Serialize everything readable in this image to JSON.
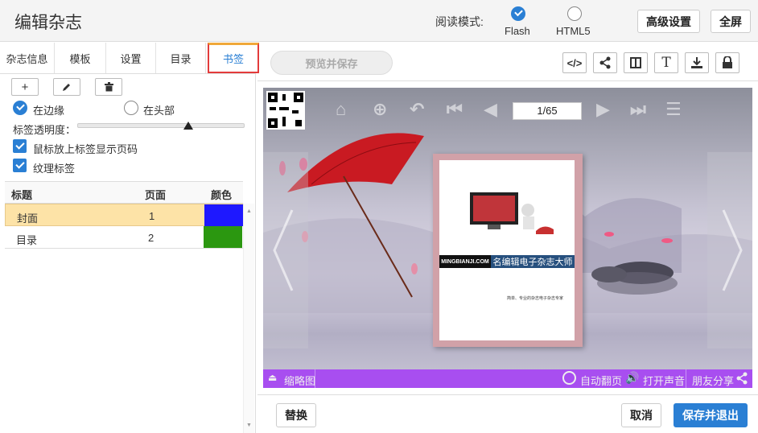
{
  "header": {
    "title": "编辑杂志",
    "mode_label": "阅读模式:",
    "flash_label": "Flash",
    "html5_label": "HTML5",
    "advanced_button": "高级设置",
    "fullscreen_button": "全屏"
  },
  "tabs": [
    "杂志信息",
    "模板",
    "设置",
    "目录",
    "书签"
  ],
  "preview_save_button": "预览并保存",
  "bookmark_options": {
    "on_edge": "在边缘",
    "on_top": "在头部",
    "opacity_label": "标签透明度：",
    "opacity_value": 0.66,
    "show_page_on_hover": "鼠标放上标签显示页码",
    "texture_label": "纹理标签"
  },
  "table": {
    "headers": [
      "标题",
      "页面",
      "颜色"
    ],
    "rows": [
      {
        "title": "封面",
        "page": "1",
        "color": "#1e18ff"
      },
      {
        "title": "目录",
        "page": "2",
        "color": "#2b9710"
      }
    ]
  },
  "viewer": {
    "page_indicator": "1/65",
    "brand_text": "MINGBIANJI.COM",
    "book_title": "名编辑电子杂志大师",
    "book_subtitle": "简单、专业的杂志电子杂志专家"
  },
  "viewer_bar": {
    "thumbnails": "缩略图",
    "autoflip": "自动翻页",
    "sound": "打开声音",
    "share": "朋友分享"
  },
  "footer": {
    "replace_button": "替换",
    "cancel_button": "取消",
    "save_exit_button": "保存并退出"
  }
}
